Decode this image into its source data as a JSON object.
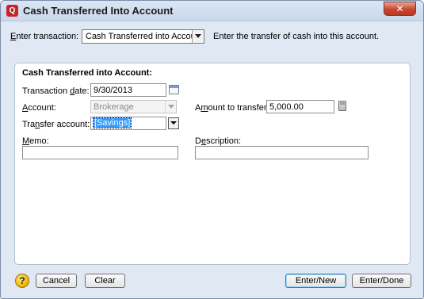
{
  "window": {
    "title": "Cash Transferred Into Account",
    "app_icon_glyph": "Q",
    "close_glyph": "✕"
  },
  "enter_transaction": {
    "label": "Enter transaction:",
    "label_accel": "E",
    "label_rest": "nter transaction:",
    "value": "Cash Transferred into Account",
    "hint": "Enter the transfer of cash into this account."
  },
  "section_title": "Cash Transferred into Account:",
  "fields": {
    "transaction_date": {
      "label_pre": "Transaction ",
      "label_accel": "d",
      "label_post": "ate:",
      "value": "9/30/2013"
    },
    "account": {
      "label_accel": "A",
      "label_post": "ccount:",
      "value": "Brokerage"
    },
    "amount": {
      "label_pre": "A",
      "label_accel": "m",
      "label_post": "ount to transfer:",
      "value": "5,000.00"
    },
    "transfer_account": {
      "label_pre": "Tra",
      "label_accel": "n",
      "label_post": "sfer account:",
      "value": "[Savings]"
    },
    "memo": {
      "label_accel": "M",
      "label_post": "emo:",
      "value": ""
    },
    "description": {
      "label_pre": "D",
      "label_accel": "e",
      "label_post": "scription:",
      "value": ""
    }
  },
  "buttons": {
    "help": "?",
    "cancel": "Cancel",
    "clear": "Clear",
    "enter_new": "Enter/New",
    "enter_done": "Enter/Done"
  },
  "icons": {
    "app": "quicken-app-icon",
    "close": "close-icon",
    "calendar": "calendar-icon",
    "calculator": "calculator-icon",
    "help": "help-icon",
    "dropdown": "chevron-down-icon"
  },
  "colors": {
    "window_bg": "#dfe8f3",
    "close_button": "#c9462f",
    "selection": "#3399ff",
    "help_icon": "#f0b400"
  }
}
